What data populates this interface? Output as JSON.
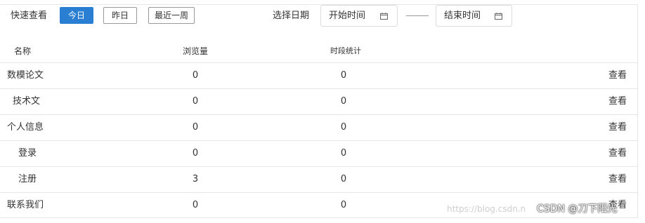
{
  "toolbar": {
    "quick_label": "快速查看",
    "buttons": [
      {
        "label": "今日",
        "active": true
      },
      {
        "label": "昨日",
        "active": false
      },
      {
        "label": "最近一周",
        "active": false
      }
    ],
    "date_label": "选择日期",
    "start_placeholder": "开始时间",
    "end_placeholder": "结束时间",
    "calendar_icon": "calendar-icon"
  },
  "table": {
    "headers": [
      "名称",
      "浏览量",
      "时段统计"
    ],
    "rows": [
      {
        "name": "数模论文",
        "views": "0",
        "stat": "0",
        "action": "查看"
      },
      {
        "name": "技术文",
        "views": "0",
        "stat": "0",
        "action": "查看"
      },
      {
        "name": "个人信息",
        "views": "0",
        "stat": "0",
        "action": "查看"
      },
      {
        "name": "登录",
        "views": "0",
        "stat": "0",
        "action": "查看"
      },
      {
        "name": "注册",
        "views": "3",
        "stat": "0",
        "action": "查看"
      },
      {
        "name": "联系我们",
        "views": "0",
        "stat": "0",
        "action": "查看"
      }
    ]
  },
  "colors": {
    "accent": "#2b7fd3",
    "border": "#e6e6e6",
    "text": "#333333"
  },
  "watermark": {
    "url": "https://blog.csdn.n",
    "brand": "CSDN @刀下阳光"
  }
}
